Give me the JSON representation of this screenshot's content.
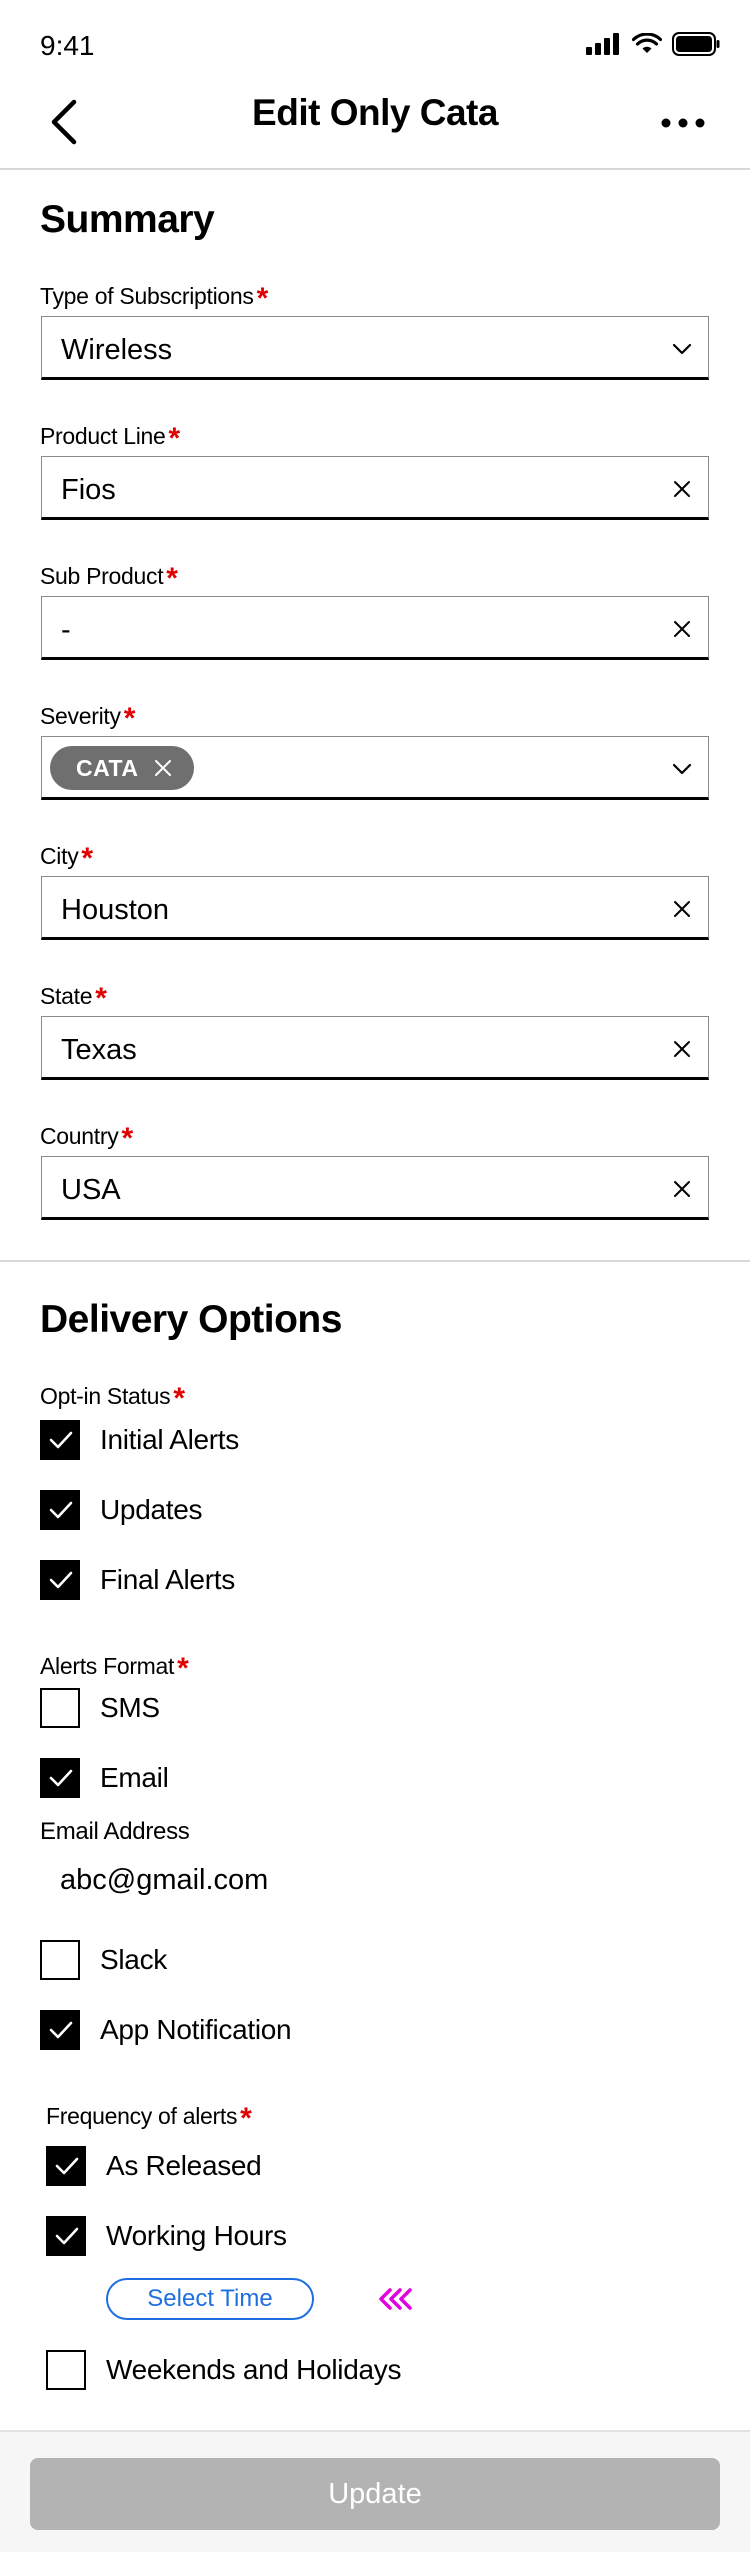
{
  "status_bar": {
    "time": "9:41"
  },
  "nav": {
    "title": "Edit Only Cata"
  },
  "summary": {
    "title": "Summary",
    "fields": {
      "subscription_type": {
        "label": "Type of Subscriptions",
        "value": "Wireless"
      },
      "product_line": {
        "label": "Product Line",
        "value": "Fios"
      },
      "sub_product": {
        "label": "Sub Product",
        "value": "-"
      },
      "severity": {
        "label": "Severity",
        "chip": "CATA"
      },
      "city": {
        "label": "City",
        "value": "Houston"
      },
      "state": {
        "label": "State",
        "value": "Texas"
      },
      "country": {
        "label": "Country",
        "value": "USA"
      }
    }
  },
  "delivery": {
    "title": "Delivery Options",
    "opt_in": {
      "label": "Opt-in Status",
      "options": [
        {
          "label": "Initial Alerts",
          "checked": true
        },
        {
          "label": "Updates",
          "checked": true
        },
        {
          "label": "Final Alerts",
          "checked": true
        }
      ]
    },
    "alerts_format": {
      "label": "Alerts Format",
      "sms": {
        "label": "SMS",
        "checked": false
      },
      "email": {
        "label": "Email",
        "checked": true
      },
      "email_address_label": "Email Address",
      "email_address_value": "abc@gmail.com",
      "slack": {
        "label": "Slack",
        "checked": false
      },
      "app_notification": {
        "label": "App Notification",
        "checked": true
      }
    },
    "frequency": {
      "label": "Frequency of alerts",
      "as_released": {
        "label": "As Released",
        "checked": true
      },
      "working_hours": {
        "label": "Working Hours",
        "checked": true
      },
      "select_time": "Select Time",
      "weekends": {
        "label": "Weekends and Holidays",
        "checked": false
      }
    }
  },
  "footer": {
    "update_label": "Update"
  },
  "colors": {
    "required": "#e00000",
    "link": "#1f6fe0",
    "arrow_accent": "#e000e0",
    "disabled_button": "#b3b3b3"
  }
}
